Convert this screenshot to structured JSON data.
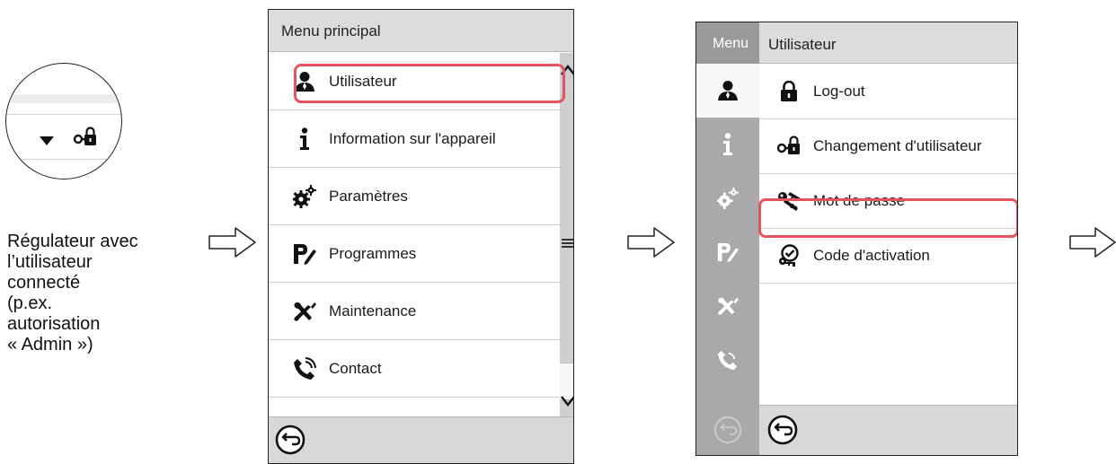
{
  "controller_detail": {
    "icons": [
      "triangle-down-icon",
      "user-switch-lock-icon"
    ],
    "caption_lines": [
      "Régulateur avec",
      "l’utilisateur",
      "connecté",
      "(p.ex.",
      "autorisation",
      "« Admin »)"
    ]
  },
  "main_menu": {
    "title": "Menu principal",
    "items": [
      {
        "label": "Utilisateur",
        "icon": "user-icon",
        "selected": true
      },
      {
        "label": "Information sur l'appareil",
        "icon": "info-icon"
      },
      {
        "label": "Paramètres",
        "icon": "gears-icon"
      },
      {
        "label": "Programmes",
        "icon": "programs-icon"
      },
      {
        "label": "Maintenance",
        "icon": "maintenance-icon"
      },
      {
        "label": "Contact",
        "icon": "phone-icon"
      }
    ],
    "scrollbar": {
      "up_icon": "chevron-up-icon",
      "mid_icon": "menu-lines-icon",
      "down_icon": "chevron-down-icon"
    },
    "back_icon": "back-arrow-icon"
  },
  "user_menu": {
    "rail_label": "Menu",
    "title": "Utilisateur",
    "rail_icons": [
      "user-icon",
      "info-icon",
      "gears-icon",
      "programs-icon",
      "maintenance-icon",
      "phone-icon"
    ],
    "items": [
      {
        "label": "Log-out",
        "icon": "lock-icon"
      },
      {
        "label": "Changement d'utilisateur",
        "icon": "user-switch-lock-icon"
      },
      {
        "label": "Mot de passe",
        "icon": "password-key-icon",
        "selected": true
      },
      {
        "label": "Code d'activation",
        "icon": "activation-code-icon"
      }
    ],
    "back_icon": "back-arrow-icon"
  },
  "colors": {
    "highlight": "#e5545e",
    "header_bg": "#dcdcdc",
    "rail_bg": "#a9a9a9"
  }
}
